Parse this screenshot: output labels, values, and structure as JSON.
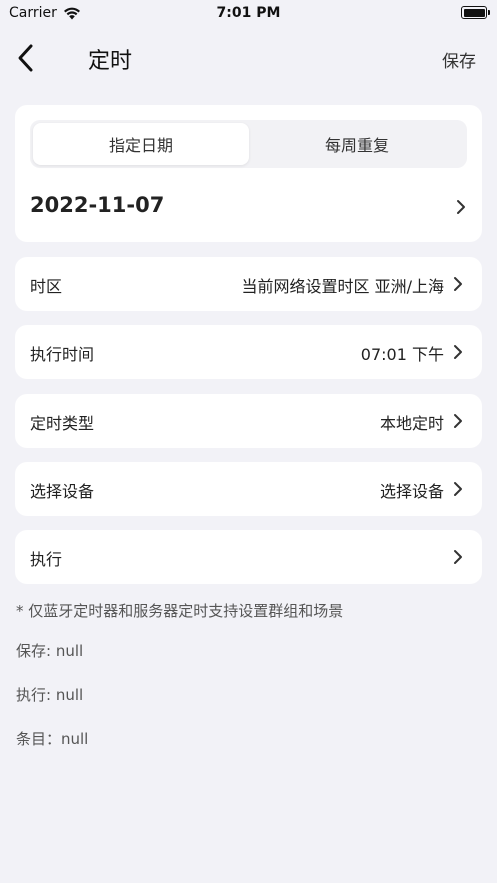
{
  "status_bar": {
    "carrier": "Carrier",
    "time": "7:01 PM",
    "wifi_icon": "wifi-icon",
    "battery_icon": "battery-icon"
  },
  "nav": {
    "back_icon": "chevron-left-icon",
    "title": "定时",
    "save_label": "保存"
  },
  "mode_tabs": [
    {
      "label": "指定日期",
      "selected": true
    },
    {
      "label": "每周重复",
      "selected": false
    }
  ],
  "date": {
    "value": "2022-11-07"
  },
  "rows": {
    "timezone": {
      "label": "时区",
      "value": "当前网络设置时区 亚洲/上海"
    },
    "exec_time": {
      "label": "执行时间",
      "value": "07:01 下午"
    },
    "timer_type": {
      "label": "定时类型",
      "value": "本地定时"
    },
    "device": {
      "label": "选择设备",
      "value": "选择设备"
    },
    "execute": {
      "label": "执行",
      "value": ""
    }
  },
  "note": "* 仅蓝牙定时器和服务器定时支持设置群组和场景",
  "debug": {
    "save": "保存: null",
    "execute": "执行: null",
    "item": "条目：null"
  },
  "colors": {
    "background": "#f2f2f7",
    "card": "#ffffff",
    "segment_bg": "#f2f2f5"
  }
}
